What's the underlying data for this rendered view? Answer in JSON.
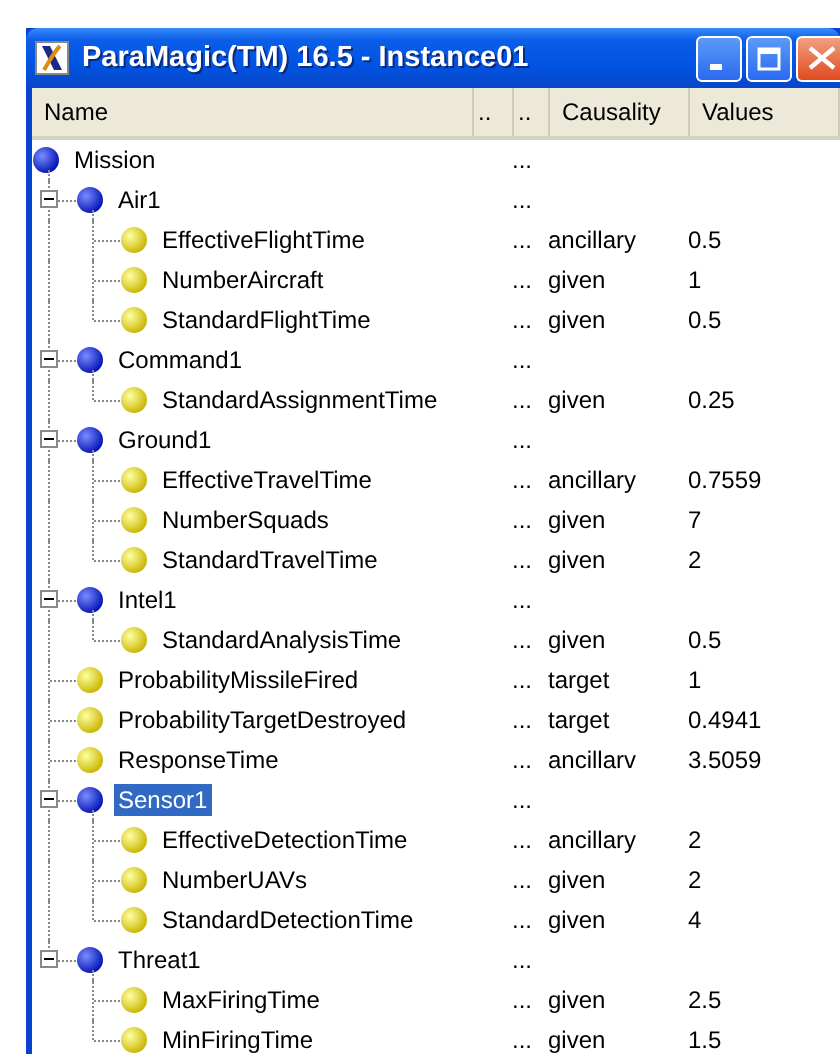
{
  "window": {
    "title": "ParaMagic(TM) 16.5 - Instance01"
  },
  "columns": [
    "Name",
    "..",
    "..",
    "Causality",
    "Values"
  ],
  "tree": [
    {
      "kind": "group",
      "name": "Mission",
      "column_3": "...",
      "selected": false,
      "children": [
        {
          "kind": "group",
          "name": "Air1",
          "column_3": "...",
          "expanded": true,
          "selected": false,
          "children": [
            {
              "kind": "param",
              "name": "EffectiveFlightTime",
              "column_3": "...",
              "causality": "ancillary",
              "value": "0.5",
              "selected": false
            },
            {
              "kind": "param",
              "name": "NumberAircraft",
              "column_3": "...",
              "causality": "given",
              "value": "1",
              "selected": false
            },
            {
              "kind": "param",
              "name": "StandardFlightTime",
              "column_3": "...",
              "causality": "given",
              "value": "0.5",
              "selected": false
            }
          ]
        },
        {
          "kind": "group",
          "name": "Command1",
          "column_3": "...",
          "expanded": true,
          "selected": false,
          "children": [
            {
              "kind": "param",
              "name": "StandardAssignmentTime",
              "column_3": "...",
              "causality": "given",
              "value": "0.25",
              "selected": false
            }
          ]
        },
        {
          "kind": "group",
          "name": "Ground1",
          "column_3": "...",
          "expanded": true,
          "selected": false,
          "children": [
            {
              "kind": "param",
              "name": "EffectiveTravelTime",
              "column_3": "...",
              "causality": "ancillary",
              "value": "0.7559",
              "selected": false
            },
            {
              "kind": "param",
              "name": "NumberSquads",
              "column_3": "...",
              "causality": "given",
              "value": "7",
              "selected": false
            },
            {
              "kind": "param",
              "name": "StandardTravelTime",
              "column_3": "...",
              "causality": "given",
              "value": "2",
              "selected": false
            }
          ]
        },
        {
          "kind": "group",
          "name": "Intel1",
          "column_3": "...",
          "expanded": true,
          "selected": false,
          "children": [
            {
              "kind": "param",
              "name": "StandardAnalysisTime",
              "column_3": "...",
              "causality": "given",
              "value": "0.5",
              "selected": false
            }
          ]
        },
        {
          "kind": "param",
          "name": "ProbabilityMissileFired",
          "column_3": "...",
          "causality": "target",
          "value": "1",
          "selected": false
        },
        {
          "kind": "param",
          "name": "ProbabilityTargetDestroyed",
          "column_3": "...",
          "causality": "target",
          "value": "0.4941",
          "selected": false
        },
        {
          "kind": "param",
          "name": "ResponseTime",
          "column_3": "...",
          "causality": "ancillarv",
          "value": "3.5059",
          "selected": false
        },
        {
          "kind": "group",
          "name": "Sensor1",
          "column_3": "...",
          "expanded": true,
          "selected": true,
          "children": [
            {
              "kind": "param",
              "name": "EffectiveDetectionTime",
              "column_3": "...",
              "causality": "ancillary",
              "value": "2",
              "selected": false
            },
            {
              "kind": "param",
              "name": "NumberUAVs",
              "column_3": "...",
              "causality": "given",
              "value": "2",
              "selected": false
            },
            {
              "kind": "param",
              "name": "StandardDetectionTime",
              "column_3": "...",
              "causality": "given",
              "value": "4",
              "selected": false
            }
          ]
        },
        {
          "kind": "group",
          "name": "Threat1",
          "column_3": "...",
          "expanded": true,
          "selected": false,
          "children": [
            {
              "kind": "param",
              "name": "MaxFiringTime",
              "column_3": "...",
              "causality": "given",
              "value": "2.5",
              "selected": false
            },
            {
              "kind": "param",
              "name": "MinFiringTime",
              "column_3": "...",
              "causality": "given",
              "value": "1.5",
              "selected": false
            }
          ]
        }
      ]
    }
  ]
}
